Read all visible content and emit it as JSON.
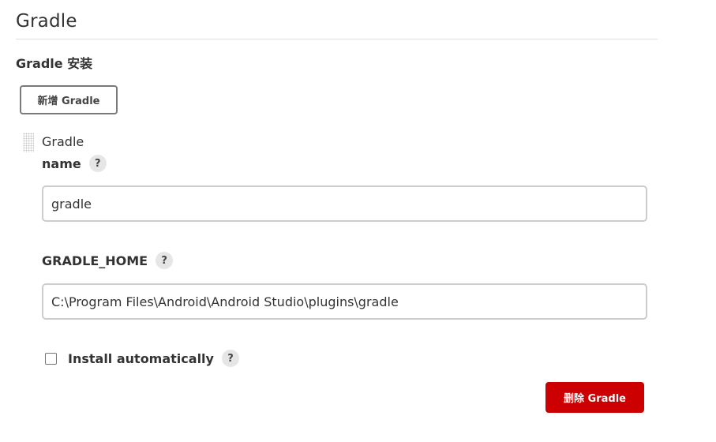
{
  "section": {
    "title": "Gradle",
    "subsection_title": "Gradle 安装",
    "add_button_label": "新增 Gradle"
  },
  "installation": {
    "title": "Gradle",
    "name_label": "name",
    "name_value": "gradle",
    "home_label": "GRADLE_HOME",
    "home_value": "C:\\Program Files\\Android\\Android Studio\\plugins\\gradle",
    "install_auto_label": "Install automatically",
    "install_auto_checked": false,
    "delete_button_label": "删除 Gradle",
    "help_glyph": "?"
  },
  "colors": {
    "delete_button": "#cc0000",
    "divider": "#dddddd",
    "input_border": "#c8cfcb"
  }
}
